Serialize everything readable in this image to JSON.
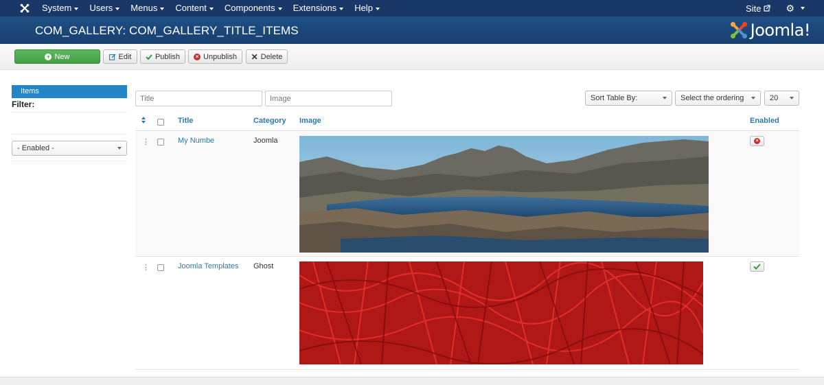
{
  "navbar": {
    "menu": [
      {
        "label": "System",
        "name": "menu-system"
      },
      {
        "label": "Users",
        "name": "menu-users"
      },
      {
        "label": "Menus",
        "name": "menu-menus"
      },
      {
        "label": "Content",
        "name": "menu-content"
      },
      {
        "label": "Components",
        "name": "menu-components"
      },
      {
        "label": "Extensions",
        "name": "menu-extensions"
      },
      {
        "label": "Help",
        "name": "menu-help"
      }
    ],
    "site_label": "Site",
    "icons": {
      "logo": "joomla-logo-icon",
      "external": "external-link-icon",
      "settings": "gear-icon"
    }
  },
  "header": {
    "title": "COM_GALLERY: COM_GALLERY_TITLE_ITEMS",
    "brand": "Joomla!"
  },
  "toolbar": {
    "new_label": "New",
    "edit_label": "Edit",
    "publish_label": "Publish",
    "unpublish_label": "Unpublish",
    "delete_label": "Delete"
  },
  "sidebar": {
    "active_item": "Items",
    "filter_label": "Filter:",
    "enabled_select": "- Enabled -"
  },
  "filters": {
    "title_placeholder": "Title",
    "image_placeholder": "Image",
    "sort_by": "Sort Table By:",
    "ordering": "Select the ordering",
    "limit": "20"
  },
  "table": {
    "headers": {
      "title": "Title",
      "category": "Category",
      "image": "Image",
      "enabled": "Enabled"
    },
    "rows": [
      {
        "title": "My Numbe",
        "category": "Joomla",
        "image": "mountain-lake-image",
        "enabled": false
      },
      {
        "title": "Joomla Templates",
        "category": "Ghost",
        "image": "red-foliage-image",
        "enabled": true
      }
    ]
  },
  "colors": {
    "navbar": "#1a3867",
    "header": "#1c4a7e",
    "link": "#2a7ab0",
    "new_button": "#4cae4c",
    "active_sidebar": "#2384c6"
  }
}
